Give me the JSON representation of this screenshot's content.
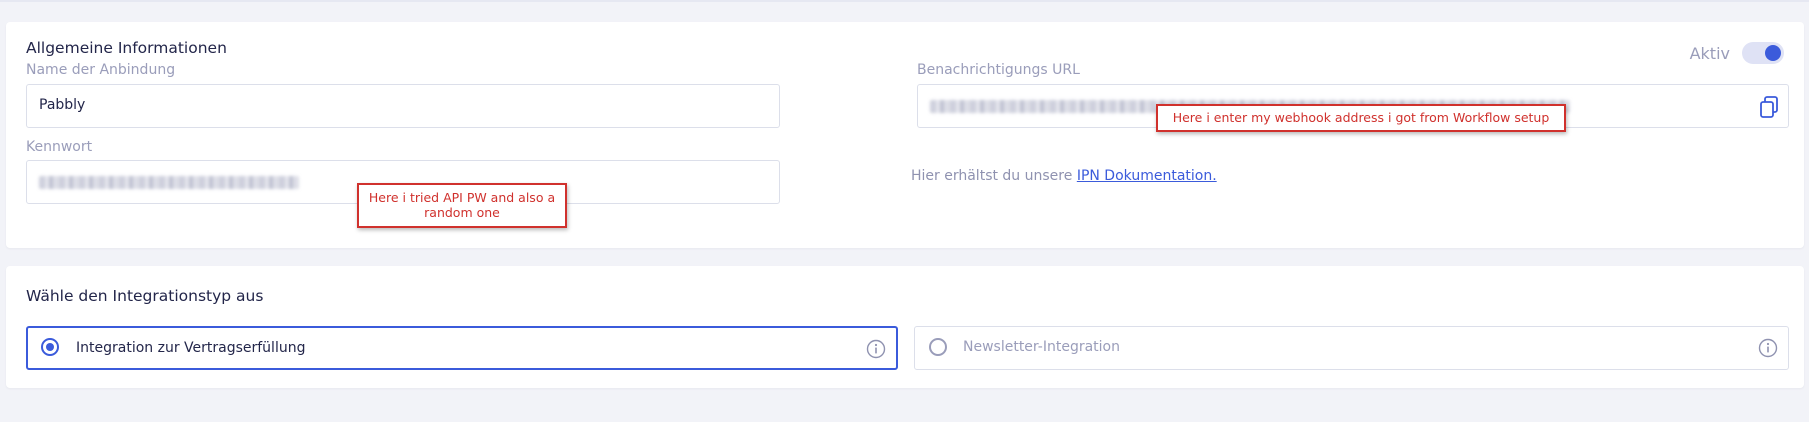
{
  "general": {
    "title": "Allgemeine Informationen",
    "active_label": "Aktiv",
    "active": true,
    "name_label": "Name der Anbindung",
    "name_value": "Pabbly",
    "url_label": "Benachrichtigungs URL",
    "password_label": "Kennwort",
    "help_text": "Hier erhältst du unsere ",
    "help_link": "IPN Dokumentation."
  },
  "annotations": {
    "webhook_note": "Here i enter my webhook address i got from Workflow setup",
    "password_note_line1": "Here i tried API PW and also a",
    "password_note_line2": "random one"
  },
  "integration": {
    "title": "Wähle den Integrationstyp aus",
    "options": [
      {
        "label": "Integration zur Vertragserfüllung",
        "selected": true
      },
      {
        "label": "Newsletter-Integration",
        "selected": false
      }
    ]
  },
  "icons": {
    "copy": "copy-icon",
    "info": "info-icon"
  },
  "colors": {
    "accent": "#3b5bdb",
    "annotation": "#d0312d",
    "background": "#f2f3f8"
  }
}
